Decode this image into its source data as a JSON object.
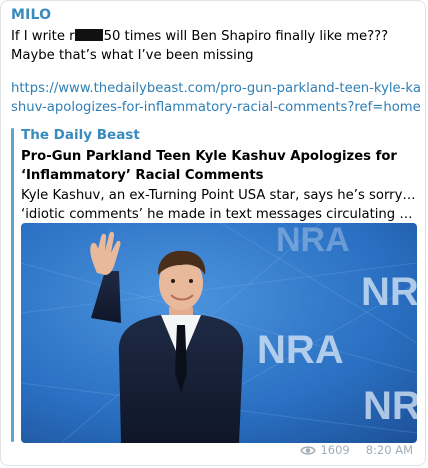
{
  "channel": {
    "sender": "MILO"
  },
  "message": {
    "text_before_redaction": "If I write r",
    "text_after_redaction": "50 times will Ben Shapiro finally like me??? Maybe that’s what I’ve been missing",
    "link": "https://www.thedailybeast.com/pro-gun-parkland-teen-kyle-kashuv-apologizes-for-inflammatory-racial-comments?ref=home"
  },
  "link_preview": {
    "site_name": "The Daily Beast",
    "title": "Pro-Gun Parkland Teen Kyle Kashuv Apologizes for ‘Inflammatory’ Racial Comments",
    "description_line1": "Kyle Kashuv, an ex-Turning Point USA star, says he’s sorry for",
    "description_line2": "‘idiotic comments’ he made in text messages circulating among ri...",
    "image_logo_text": "NRA"
  },
  "footer": {
    "views_icon": "eye-icon",
    "views": "1609",
    "time": "8:20 AM"
  },
  "colors": {
    "accent": "#3a8bbd",
    "link": "#2f7fb5",
    "meta": "#a3adb6",
    "image_background": "#2a6fc2"
  }
}
